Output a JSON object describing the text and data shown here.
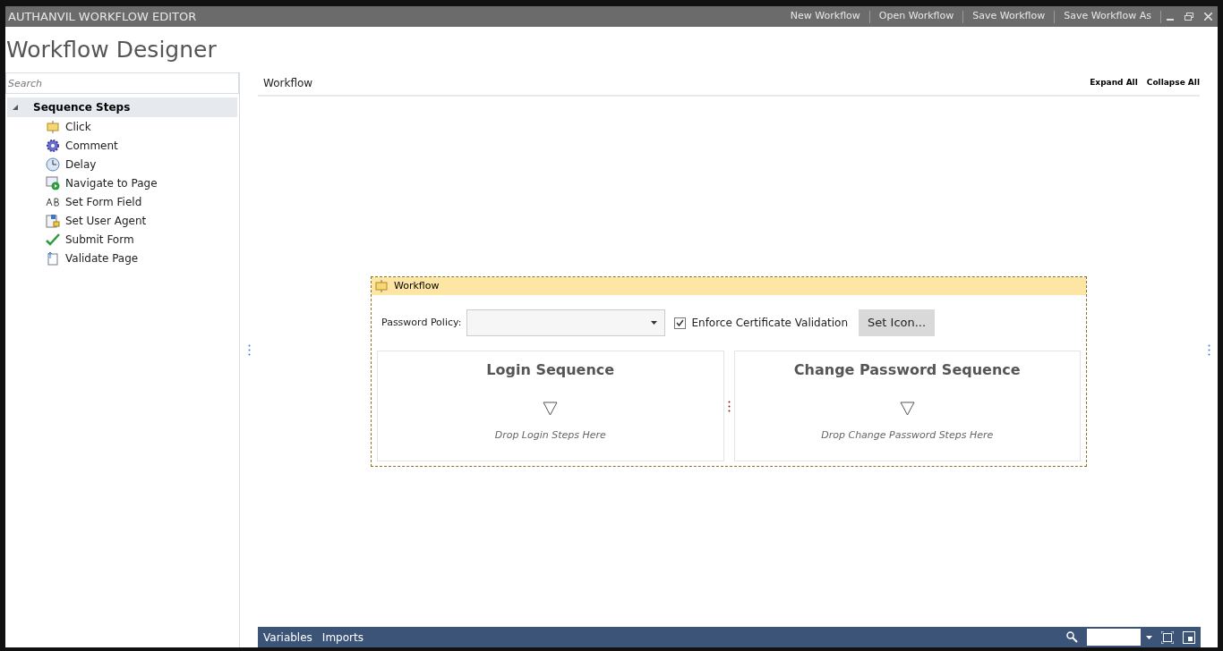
{
  "window": {
    "title": "AUTHANVIL WORKFLOW EDITOR",
    "menu": [
      "New Workflow",
      "Open Workflow",
      "Save Workflow",
      "Save Workflow As"
    ]
  },
  "page_title": "Workflow Designer",
  "sidebar": {
    "search": {
      "placeholder": "Search"
    },
    "tree": [
      {
        "label": "Sequence Steps",
        "expanded": true,
        "selected": true,
        "children": [
          {
            "label": "Click",
            "kind": "click"
          },
          {
            "label": "Comment",
            "kind": "comment"
          },
          {
            "label": "Delay",
            "kind": "delay"
          },
          {
            "label": "Navigate to Page",
            "kind": "navigate"
          },
          {
            "label": "Set Form Field",
            "kind": "formfield"
          },
          {
            "label": "Set User Agent",
            "kind": "useragent"
          },
          {
            "label": "Submit Form",
            "kind": "submit"
          },
          {
            "label": "Validate Page",
            "kind": "validate"
          }
        ]
      }
    ]
  },
  "designer": {
    "breadcrumb": "Workflow",
    "actions": [
      "Expand All",
      "Collapse All"
    ],
    "activity": {
      "title": "Workflow",
      "password_policy": {
        "label": "Password Policy:"
      },
      "enforce": {
        "label": "Enforce Certificate Validation",
        "checked": true
      },
      "set_icon": "Set Icon...",
      "sequences": [
        {
          "title": "Login Sequence",
          "hint": "Drop Login Steps Here"
        },
        {
          "title": "Change Password Sequence",
          "hint": "Drop Change Password Steps Here"
        }
      ]
    }
  },
  "bottom_bar": {
    "tabs": [
      "Variables",
      "Imports"
    ]
  }
}
